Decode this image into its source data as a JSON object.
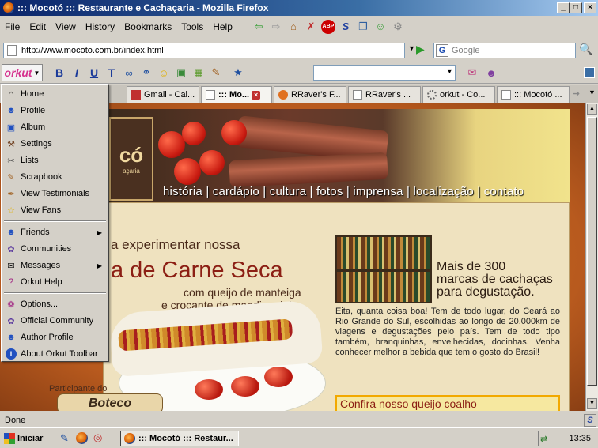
{
  "window": {
    "title": "::: Mocotó ::: Restaurante e Cachaçaria - Mozilla Firefox",
    "controls": [
      "minimize",
      "maximize",
      "close"
    ]
  },
  "menubar": {
    "items": [
      "File",
      "Edit",
      "View",
      "History",
      "Bookmarks",
      "Tools",
      "Help"
    ],
    "icons": [
      "back-arrow-icon",
      "forward-arrow-icon",
      "home-icon",
      "blocked-icon",
      "adblock-icon",
      "stumble-icon",
      "copy-icon",
      "frog-icon",
      "gear-icon"
    ],
    "adblock_label": "ABP"
  },
  "navbar": {
    "url": "http://www.mocoto.com.br/index.html",
    "search_placeholder": "Google",
    "search_engine": "G"
  },
  "orkut_toolbar": {
    "logo": "orkut",
    "format_buttons": [
      "B",
      "I",
      "U",
      "T"
    ],
    "input_value": ""
  },
  "tabs": [
    {
      "label": "Gmail - Cai...",
      "active": false
    },
    {
      "label": "::: Mo...",
      "active": true
    },
    {
      "label": "RRaver's F...",
      "active": false
    },
    {
      "label": "RRaver's ...",
      "active": false
    },
    {
      "label": "orkut - Co...",
      "active": false
    },
    {
      "label": "::: Mocotó ...",
      "active": false
    }
  ],
  "dropdown": {
    "group1": [
      "Home",
      "Profile",
      "Album",
      "Settings",
      "Lists",
      "Scrapbook",
      "View Testimonials",
      "View Fans"
    ],
    "group2": [
      "Friends",
      "Communities",
      "Messages",
      "Orkut Help"
    ],
    "group3": [
      "Options...",
      "Official Community",
      "Author Profile",
      "About Orkut Toolbar"
    ]
  },
  "page": {
    "nav": "história | cardápio | cultura | fotos | imprensa | localização | contato",
    "logo_text": "có",
    "logo_sub": "açaria",
    "headline1": "a experimentar nossa",
    "headline2": "a de Carne Seca",
    "headline3a": "com queijo de manteiga",
    "headline3b": "e crocante de mandioquinha",
    "side_heading1": "Mais de 300",
    "side_heading2": "marcas de cachaças",
    "side_heading3": "para degustação.",
    "body": "Eita, quanta coisa boa! Tem de todo lugar, do Ceará ao Rio Grande do Sul, escolhidas ao longo de 20.000km de viagens e degustações pelo país. Tem de todo tipo também, branquinhas, envelhecidas, docinhas. Venha conhecer melhor a bebida que tem o gosto do Brasil!",
    "queijo": "Confira nosso queijo coalho",
    "participante": "Participante do",
    "boteco": "Boteco"
  },
  "status": {
    "text": "Done"
  },
  "taskbar": {
    "start": "Iniciar",
    "task": "::: Mocotó ::: Restaur...",
    "clock": "13:35"
  }
}
